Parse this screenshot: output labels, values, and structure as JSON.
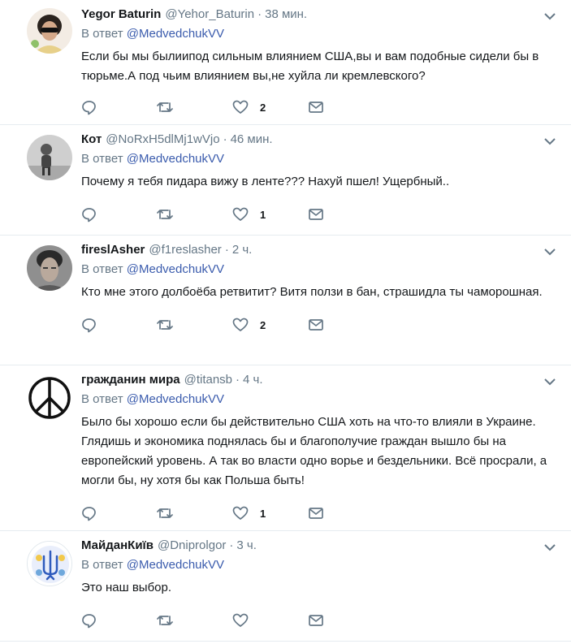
{
  "tweets": [
    {
      "name": "Yegor Baturin",
      "handle": "@Yehor_Baturin",
      "time": "38 мин.",
      "reply_prefix": "В ответ",
      "reply_to": "@MedvedchukVV",
      "text": "Если бы мы былиипод сильным влиянием США,вы и вам подобные сидели бы в тюрьме.А под чьим влиянием вы,не хуйла ли кремлевского?",
      "likes": "2",
      "avatar": "photo-sunglasses-avatar"
    },
    {
      "name": "Кот",
      "handle": "@NoRxH5dlMj1wVjo",
      "time": "46 мин.",
      "reply_prefix": "В ответ",
      "reply_to": "@MedvedchukVV",
      "text": "Почему я тебя пидара вижу в ленте??? Нахуй пшел! Ущербный..",
      "likes": "1",
      "avatar": "grayscale-child-photo-avatar"
    },
    {
      "name": "fireslAsher",
      "handle": "@f1reslasher",
      "time": "2 ч.",
      "reply_prefix": "В ответ",
      "reply_to": "@MedvedchukVV",
      "text": "Кто мне этого долбоёба ретвитит? Витя ползи в бан, страшидла ты чаморошная.",
      "likes": "2",
      "avatar": "portrait-photo-avatar"
    },
    {
      "name": "гражданин мира",
      "handle": "@titansb",
      "time": "4 ч.",
      "reply_prefix": "В ответ",
      "reply_to": "@MedvedchukVV",
      "text": "Было бы хорошо если бы действительно США хоть на что-то влияли в Украине. Глядишь и экономика поднялась бы и благополучие граждан вышло бы на европейский уровень. А так во власти одно ворье и бездельники. Всё просрали, а могли бы, ну хотя бы как Польша быть!",
      "likes": "1",
      "avatar": "peace-symbol-avatar"
    },
    {
      "name": "МайданКиїв",
      "handle": "@Dniprolgor",
      "time": "3 ч.",
      "reply_prefix": "В ответ",
      "reply_to": "@MedvedchukVV",
      "text": "Это наш выбор.",
      "likes": "",
      "avatar": "trident-floral-avatar"
    }
  ],
  "dot": "·",
  "colors": {
    "link": "#3b5cad",
    "muted": "#657786",
    "divider": "#e6ecf0"
  }
}
